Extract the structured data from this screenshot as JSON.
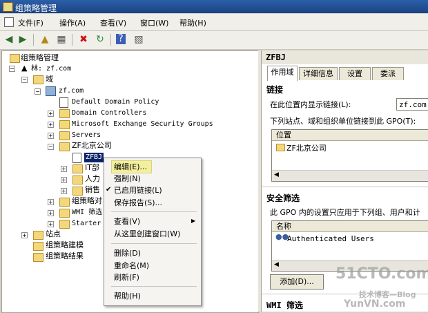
{
  "window": {
    "title": "组策略管理"
  },
  "menubar": {
    "items": [
      "文件(F)",
      "操作(A)",
      "查看(V)",
      "窗口(W)",
      "帮助(H)"
    ]
  },
  "tree": {
    "root": "组策略管理",
    "forest": "林: zf.com",
    "domains": "域",
    "domain": "zf.com",
    "items": [
      "Default Domain Policy",
      "Domain Controllers",
      "Microsoft Exchange Security Groups",
      "Servers",
      "ZF北京公司"
    ],
    "selected": "ZFBJ",
    "ou_children": [
      "IT部",
      "人力",
      "销售"
    ],
    "partial": [
      "组策略对",
      "WMI 筛选",
      "Starter"
    ],
    "sites": "站点",
    "modeling": "组策略建模",
    "results": "组策略结果"
  },
  "context_menu": {
    "items": [
      "编辑(E)...",
      "强制(N)",
      "已启用链接(L)",
      "保存报告(S)...",
      "查看(V)",
      "从这里创建窗口(W)",
      "删除(D)",
      "重命名(M)",
      "刷新(F)",
      "帮助(H)"
    ],
    "checked_index": 2,
    "highlighted_index": 0
  },
  "details": {
    "title": "ZFBJ",
    "tabs": [
      "作用域",
      "详细信息",
      "设置",
      "委派"
    ],
    "links_heading": "链接",
    "links_location_label": "在此位置内显示链接(L):",
    "links_location_value": "zf.com",
    "links_desc": "下列站点、域和组织单位链接到此 GPO(T):",
    "links_col": "位置",
    "links_row": "ZF北京公司",
    "security_heading": "安全筛选",
    "security_desc": "此 GPO 内的设置只应用于下列组、用户和计",
    "security_col": "名称",
    "security_row": "Authenticated Users",
    "add_button": "添加(D)...",
    "wmi_heading": "WMI 筛选"
  },
  "watermark": {
    "main": "51CTO.com",
    "sub": "技术博客—Blog",
    "site": "YunVN.com"
  }
}
